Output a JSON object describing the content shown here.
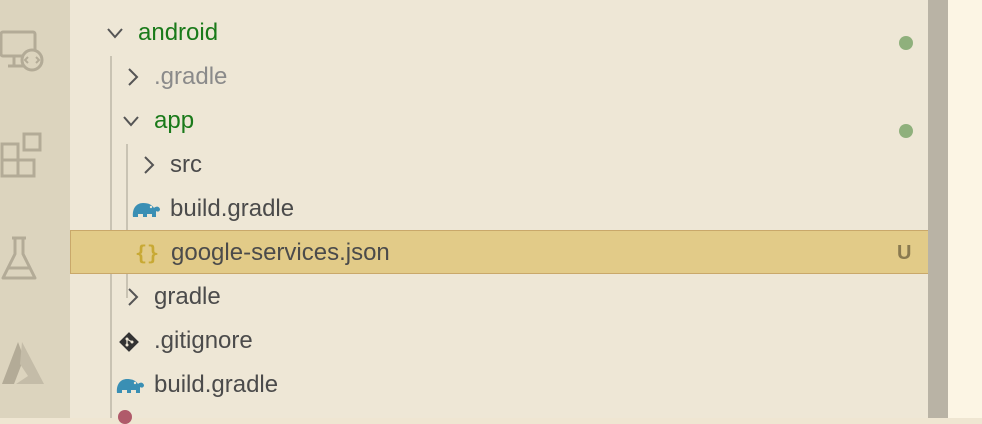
{
  "activity_bar": {
    "items": [
      {
        "name": "remote-explorer-icon"
      },
      {
        "name": "extensions-icon"
      },
      {
        "name": "testing-icon"
      },
      {
        "name": "azure-icon"
      }
    ]
  },
  "tree": {
    "rows": [
      {
        "label": "android",
        "kind": "folder",
        "expanded": true,
        "git": "modified"
      },
      {
        "label": ".gradle",
        "kind": "folder",
        "expanded": false,
        "git": "ignored"
      },
      {
        "label": "app",
        "kind": "folder",
        "expanded": true,
        "git": "modified"
      },
      {
        "label": "src",
        "kind": "folder",
        "expanded": false
      },
      {
        "label": "build.gradle",
        "kind": "gradle-file"
      },
      {
        "label": "google-services.json",
        "kind": "json-file",
        "selected": true,
        "status": "U"
      },
      {
        "label": "gradle",
        "kind": "folder",
        "expanded": false
      },
      {
        "label": ".gitignore",
        "kind": "git-file"
      },
      {
        "label": "build.gradle",
        "kind": "gradle-file"
      }
    ]
  },
  "colors": {
    "git_modified": "#1a7a1a",
    "git_ignored": "#8a8a8a",
    "selection": "#e2cb88",
    "modified_dot": "#8fb07c",
    "gradle_blue": "#3a8fb4",
    "json_yellow": "#c8a934"
  }
}
